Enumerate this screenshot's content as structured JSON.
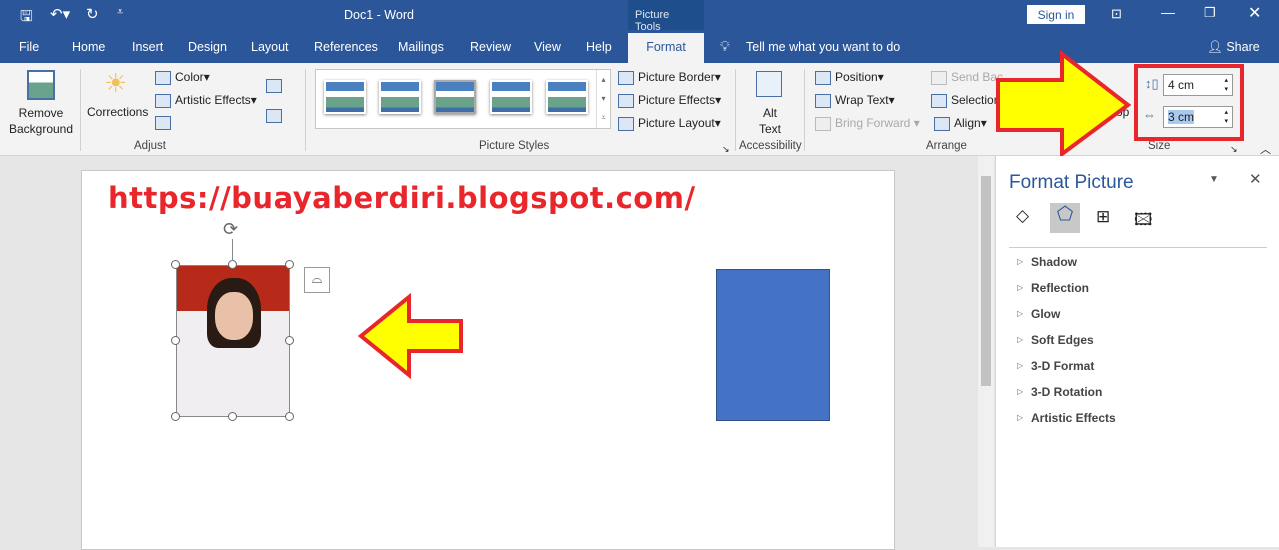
{
  "titlebar": {
    "title": "Doc1  -  Word",
    "context": "Picture Tools",
    "sign_in": "Sign in"
  },
  "tabs": [
    "File",
    "Home",
    "Insert",
    "Design",
    "Layout",
    "References",
    "Mailings",
    "Review",
    "View",
    "Help",
    "Format"
  ],
  "active_tab": "Format",
  "tell_me": "Tell me what you want to do",
  "share": "Share",
  "ribbon": {
    "remove_background": "Remove Background",
    "corrections": "Corrections",
    "color": "Color",
    "artistic_effects": "Artistic Effects",
    "adjust": "Adjust",
    "picture_styles": "Picture Styles",
    "picture_border": "Picture Border",
    "picture_effects": "Picture Effects",
    "picture_layout": "Picture Layout",
    "alt_text": "Alt Text",
    "accessibility": "Accessibility",
    "position": "Position",
    "wrap_text": "Wrap Text",
    "bring_forward": "Bring Forward",
    "send_backward": "Send Bac",
    "selection": "Selection",
    "align": "Align",
    "arrange": "Arrange",
    "crop": "op",
    "height": "4 cm",
    "width": "3 cm",
    "size": "Size"
  },
  "document": {
    "watermark_url": "https://buayaberdiri.blogspot.com/",
    "shape_color": "#4472c4"
  },
  "pane": {
    "title": "Format Picture",
    "items": [
      "Shadow",
      "Reflection",
      "Glow",
      "Soft Edges",
      "3-D Format",
      "3-D Rotation",
      "Artistic Effects"
    ]
  },
  "colors": {
    "brand": "#2b579a",
    "annotation_red": "#e8262b",
    "annotation_yellow": "#ffff00"
  }
}
